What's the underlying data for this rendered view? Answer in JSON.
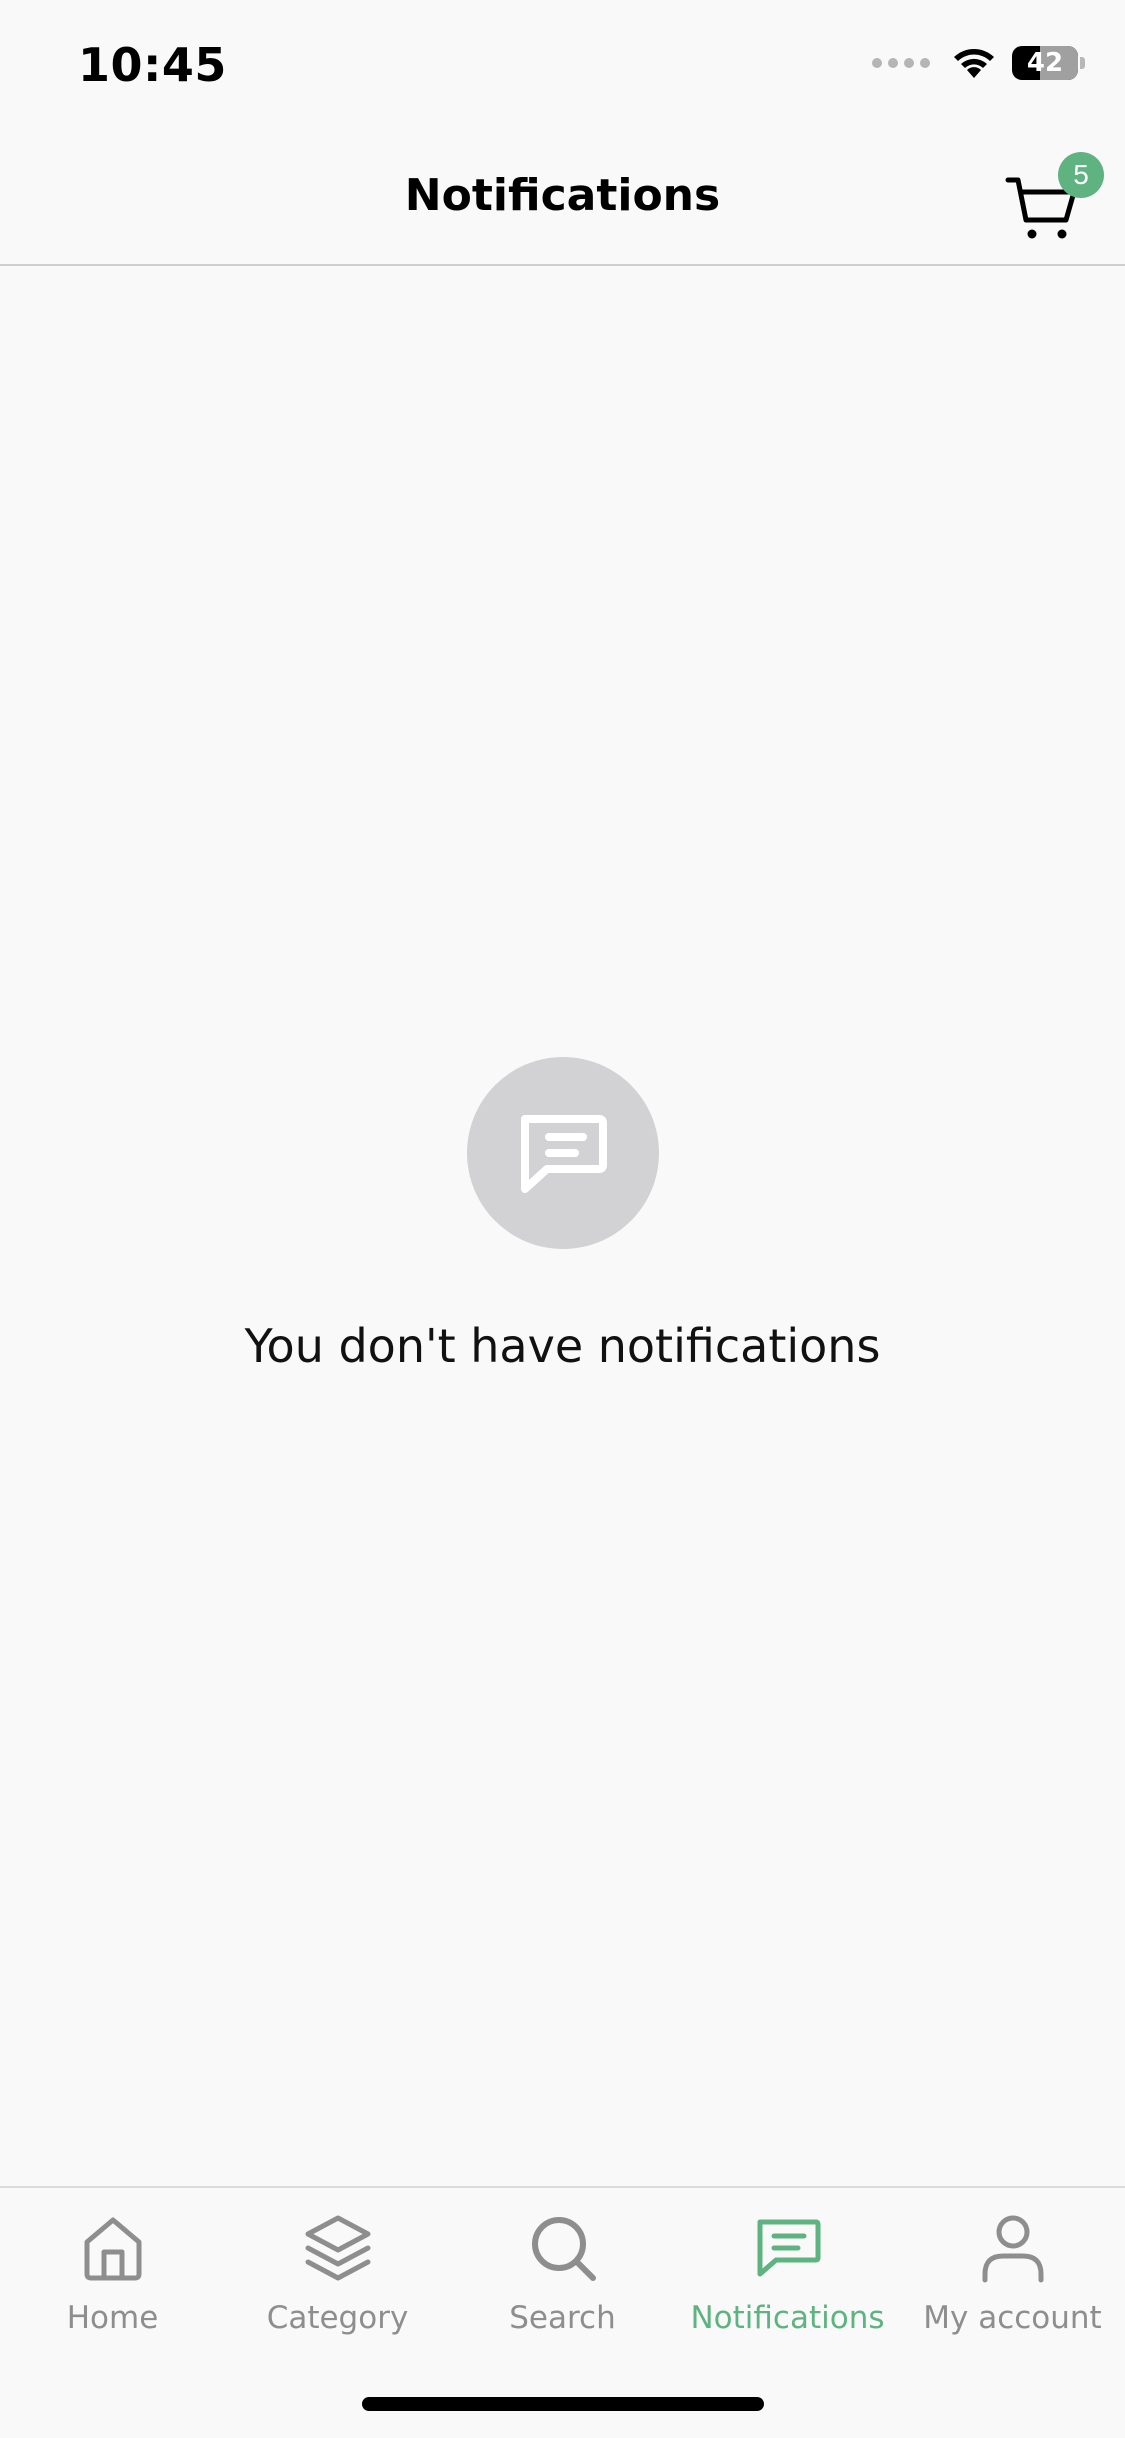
{
  "status_bar": {
    "time": "10:45",
    "battery": "42",
    "battery_level": 0.42
  },
  "header": {
    "title": "Notifications",
    "cart_count": "5"
  },
  "empty_state": {
    "icon": "message-square-icon",
    "message": "You don't have notifications"
  },
  "tabs": [
    {
      "label": "Home",
      "icon": "home-icon",
      "active": false
    },
    {
      "label": "Category",
      "icon": "layers-icon",
      "active": false
    },
    {
      "label": "Search",
      "icon": "search-icon",
      "active": false
    },
    {
      "label": "Notifications",
      "icon": "message-square-icon",
      "active": true
    },
    {
      "label": "My account",
      "icon": "user-icon",
      "active": false
    }
  ],
  "colors": {
    "accent": "#5fb381",
    "inactive": "#8e8e8e",
    "background": "#f9f9f9",
    "empty_circle": "#d2d2d5"
  }
}
